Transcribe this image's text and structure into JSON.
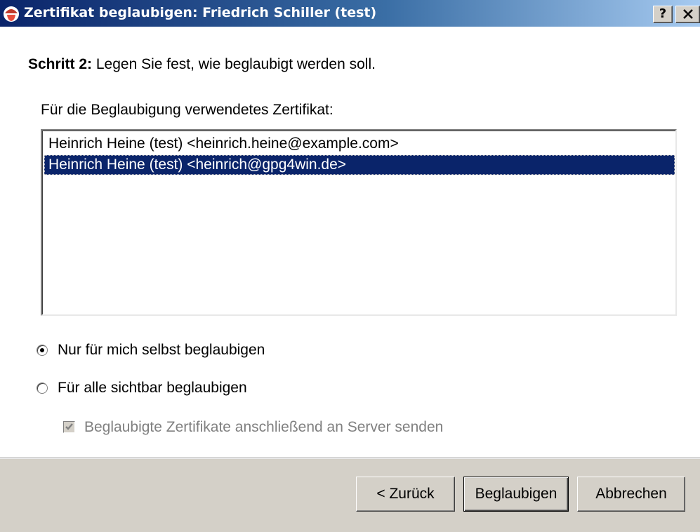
{
  "window": {
    "title": "Zertifikat beglaubigen: Friedrich Schiller (test)",
    "title_icon": "gpg4win-app-icon",
    "help_button": "?",
    "close_button": "×"
  },
  "step": {
    "label": "Schritt 2:",
    "text": " Legen Sie fest, wie beglaubigt werden soll."
  },
  "certificate_list": {
    "label": "Für die Beglaubigung verwendetes Zertifikat:",
    "items": [
      {
        "text": "Heinrich Heine (test) <heinrich.heine@example.com>",
        "selected": false
      },
      {
        "text": "Heinrich Heine (test) <heinrich@gpg4win.de>",
        "selected": true
      }
    ]
  },
  "options": {
    "radio_self": {
      "label": "Nur für mich selbst beglaubigen",
      "checked": true
    },
    "radio_all": {
      "label": "Für alle sichtbar beglaubigen",
      "checked": false
    },
    "send_to_server": {
      "label": "Beglaubigte Zertifikate anschließend an Server senden",
      "checked": true,
      "disabled": true
    }
  },
  "buttons": {
    "back": "< Zurück",
    "sign": "Beglaubigen",
    "cancel": "Abbrechen"
  },
  "colors": {
    "titlebar_start": "#0a246a",
    "titlebar_end": "#a6caf0",
    "selection": "#0a246a",
    "dialog_face": "#d4d0c8"
  }
}
